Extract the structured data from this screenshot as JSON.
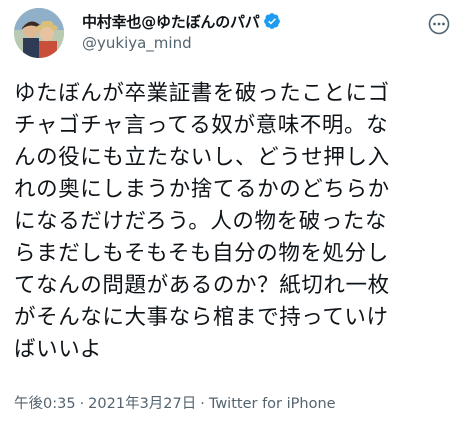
{
  "author": {
    "display_name": "中村幸也@ゆたぼんのパパ",
    "handle": "@yukiya_mind",
    "verified_icon": "verified-badge-icon",
    "verified_color": "#1d9bf0"
  },
  "tweet": {
    "text": "ゆたぼんが卒業証書を破ったことにゴ\nチャゴチャ言ってる奴が意味不明。な\nんの役にも立たないし、どうせ押し入\nれの奥にしまうか捨てるかのどちらか\nになるだけだろう。人の物を破ったな\nらまだしもそもそも自分の物を処分し\nてなんの問題があるのか？紙切れ一枚\nがそんなに大事なら棺まで持っていけ\nばいいよ",
    "time": "午後0:35",
    "separator": "·",
    "date": "2021年3月27日",
    "source": "Twitter for iPhone"
  },
  "icons": {
    "more": "more-options-icon",
    "avatar": "avatar-photo"
  }
}
